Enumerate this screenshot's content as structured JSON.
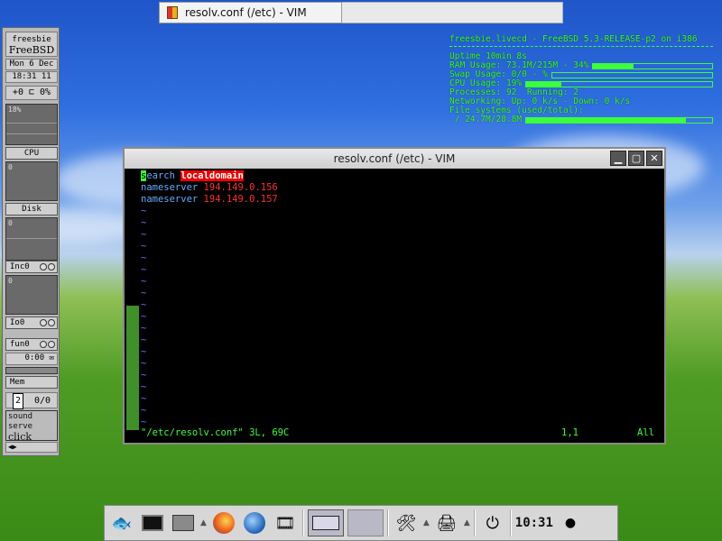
{
  "taskbar_top": {
    "title": "resolv.conf (/etc) - VIM"
  },
  "conky": {
    "header": "freesbie.livecd - FreeBSD 5.3-RELEASE-p2 on i386",
    "uptime_label": "Uptime",
    "uptime": "10min 8s",
    "ram_label": "RAM Usage:",
    "ram": "73.1M/215M - 34%",
    "ram_pct": 34,
    "swap_label": "Swap Usage:",
    "swap": "0/0 - %",
    "swap_pct": 0,
    "cpu_label": "CPU Usage:",
    "cpu": "19%",
    "cpu_pct": 19,
    "processes_label": "Processes:",
    "processes": "92",
    "running_label": "Running:",
    "running": "2",
    "networking": "Networking: Up: 0 k/s - Down: 0 k/s",
    "fs_label": "File systems (used/total):",
    "fs": "/ 24.7M/28.8M",
    "fs_pct": 86
  },
  "dock": {
    "brand_top": "freesbie",
    "brand_bottom": "FreeBSD",
    "date": "Mon 6 Dec",
    "time": "18:31 11",
    "load": "+0 ⊏ 0%",
    "cpu_pct": "18%",
    "cpu_label": "CPU",
    "disk_val": "0",
    "disk_label": "Disk",
    "disk_val2": "0",
    "inc_label": "Inc0",
    "inc_val": "0",
    "io_label": "Io0",
    "fun_label": "fun0",
    "fun_time": "0:00",
    "mem_label": "Mem",
    "mail": "0/0",
    "sound1": "sound serve",
    "sound2": "click here t"
  },
  "vim": {
    "window_title": "resolv.conf (/etc) - VIM",
    "line1_kw_rest": "earch",
    "line1_cursor": "s",
    "line1_val": "localdomain",
    "line2_kw": "nameserver",
    "line2_ip": "194.149.0.156",
    "line3_kw": "nameserver",
    "line3_ip": "194.149.0.157",
    "tilde": "~",
    "status_file": "\"/etc/resolv.conf\" 3L, 69C",
    "status_pos": "1,1",
    "status_all": "All"
  },
  "panel": {
    "clock": "10:31"
  },
  "colors": {
    "terminal_green": "#3aff3a",
    "ip_red": "#ff2e2e",
    "keyword_blue": "#67a9ff"
  }
}
